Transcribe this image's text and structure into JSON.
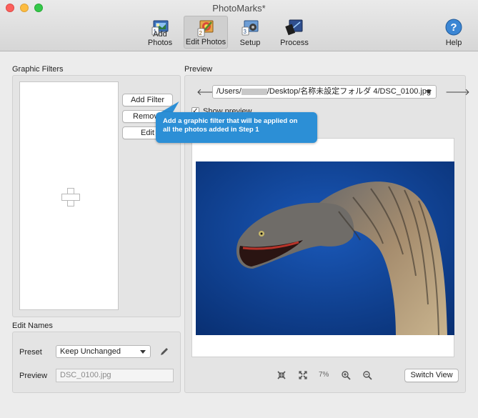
{
  "window": {
    "title": "PhotoMarks*"
  },
  "toolbar": {
    "items": [
      {
        "label": "Add Photos",
        "icon": "add-photos-icon",
        "badge": "1"
      },
      {
        "label": "Edit Photos",
        "icon": "edit-photos-icon",
        "badge": "2"
      },
      {
        "label": "Setup",
        "icon": "setup-icon",
        "badge": "3"
      },
      {
        "label": "Process",
        "icon": "process-icon"
      },
      {
        "label": "Help",
        "icon": "help-icon"
      }
    ]
  },
  "graphic_filters": {
    "title": "Graphic Filters",
    "add_label": "Add Filter",
    "remove_label": "Remove",
    "edit_label": "Edit",
    "empty_icon": "plus-icon"
  },
  "edit_names": {
    "title": "Edit Names",
    "preset_label": "Preset",
    "preset_value": "Keep Unchanged",
    "preview_label": "Preview",
    "preview_value": "DSC_0100.jpg"
  },
  "preview": {
    "title": "Preview",
    "path_start": "/Users/",
    "path_end": "/Desktop/名称未設定フォルダ 4/DSC_0100.jpg",
    "show_preview_label": "Show preview",
    "show_preview_checked": true,
    "zoom_level": "7%",
    "switch_view_label": "Switch View"
  },
  "tooltip": {
    "line1": "Add a graphic filter that will be applied on",
    "line2": "all the photos added in Step 1"
  },
  "colors": {
    "tooltip": "#2c8fd6",
    "photo_background": "#0d3d8a"
  }
}
